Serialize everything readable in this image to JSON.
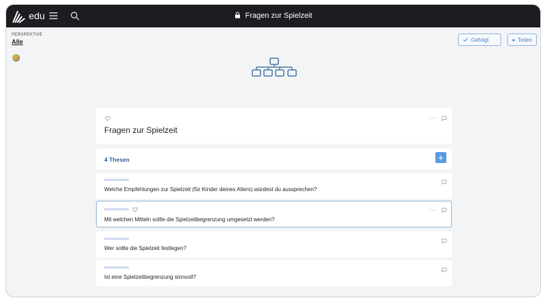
{
  "topbar": {
    "logo_text": "edu",
    "title": "Fragen zur Spielzeit"
  },
  "perspective": {
    "label": "PERSPEKTIVE",
    "value": "Alle"
  },
  "actions": {
    "followed_label": "Gefolgt",
    "share_label": "Teilen"
  },
  "discussion": {
    "title": "Fragen zur Spielzeit",
    "theses_label": "4 Thesen",
    "add_label": "+",
    "more_label": "···"
  },
  "theses": [
    {
      "text": "Welche Empfehlungen zur Spielzeit (für Kinder deines Alters) würdest du aussprechen?"
    },
    {
      "text": "Mit welchen Mitteln sollte die Spielzeitbegrenzung umgesetzt werden?"
    },
    {
      "text": "Wer sollte die Spielzeit festlegen?"
    },
    {
      "text": "Ist eine Spielzeitbegrenzung sinnvoll?"
    }
  ],
  "colors": {
    "topbar": "#1c1d20",
    "accent": "#4a86c5",
    "theses_label": "#2c5f99",
    "background": "#f3f4f6"
  },
  "icons": [
    "logo-icon",
    "menu-icon",
    "search-icon",
    "lock-icon",
    "check-icon",
    "tree-icon",
    "heart-icon",
    "comment-icon",
    "more-icon"
  ]
}
